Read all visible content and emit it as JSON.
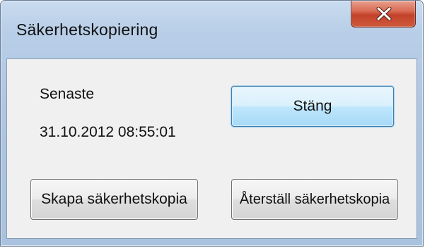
{
  "window": {
    "title": "Säkerhetskopiering"
  },
  "titlebar": {
    "close_icon": "close-icon"
  },
  "backup_info": {
    "last_label": "Senaste",
    "last_timestamp": "31.10.2012 08:55:01"
  },
  "buttons": {
    "close_label": "Stäng",
    "create_backup_label": "Skapa säkerhetskopia",
    "restore_backup_label": "Återställ säkerhetskopia"
  },
  "colors": {
    "frame": "#aec6e2",
    "client_background": "#f0f0f0",
    "close_button": "#c2412a",
    "default_button_border": "#3c7fb1"
  }
}
